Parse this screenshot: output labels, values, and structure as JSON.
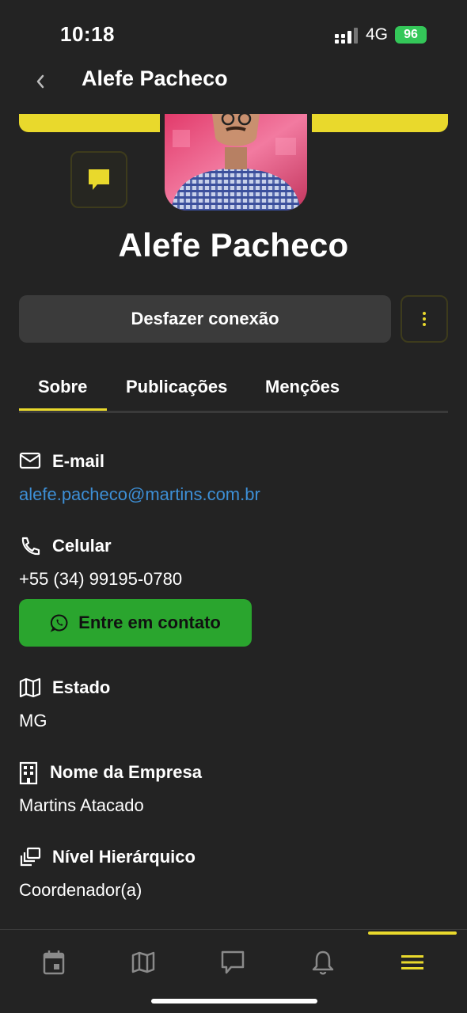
{
  "status_bar": {
    "time": "10:18",
    "network": "4G",
    "battery": "96"
  },
  "nav": {
    "title": "Alefe Pacheco"
  },
  "profile": {
    "name": "Alefe Pacheco",
    "disconnect_label": "Desfazer conexão"
  },
  "tabs": [
    {
      "label": "Sobre"
    },
    {
      "label": "Publicações"
    },
    {
      "label": "Menções"
    }
  ],
  "fields": {
    "email": {
      "label": "E-mail",
      "value": "alefe.pacheco@martins.com.br"
    },
    "phone": {
      "label": "Celular",
      "value": "+55 (34) 99195-0780",
      "contact_button": "Entre em contato"
    },
    "state": {
      "label": "Estado",
      "value": "MG"
    },
    "company": {
      "label": "Nome da Empresa",
      "value": "Martins Atacado"
    },
    "level": {
      "label": "Nível Hierárquico",
      "value": "Coordenador(a)"
    }
  },
  "bottom_nav": [
    {
      "icon": "calendar-icon"
    },
    {
      "icon": "map-icon"
    },
    {
      "icon": "chat-icon"
    },
    {
      "icon": "bell-icon"
    },
    {
      "icon": "menu-icon",
      "active": true
    }
  ],
  "colors": {
    "accent": "#e9d92c",
    "whatsapp": "#2aa52e",
    "link": "#3d8fd6",
    "background": "#232323"
  }
}
